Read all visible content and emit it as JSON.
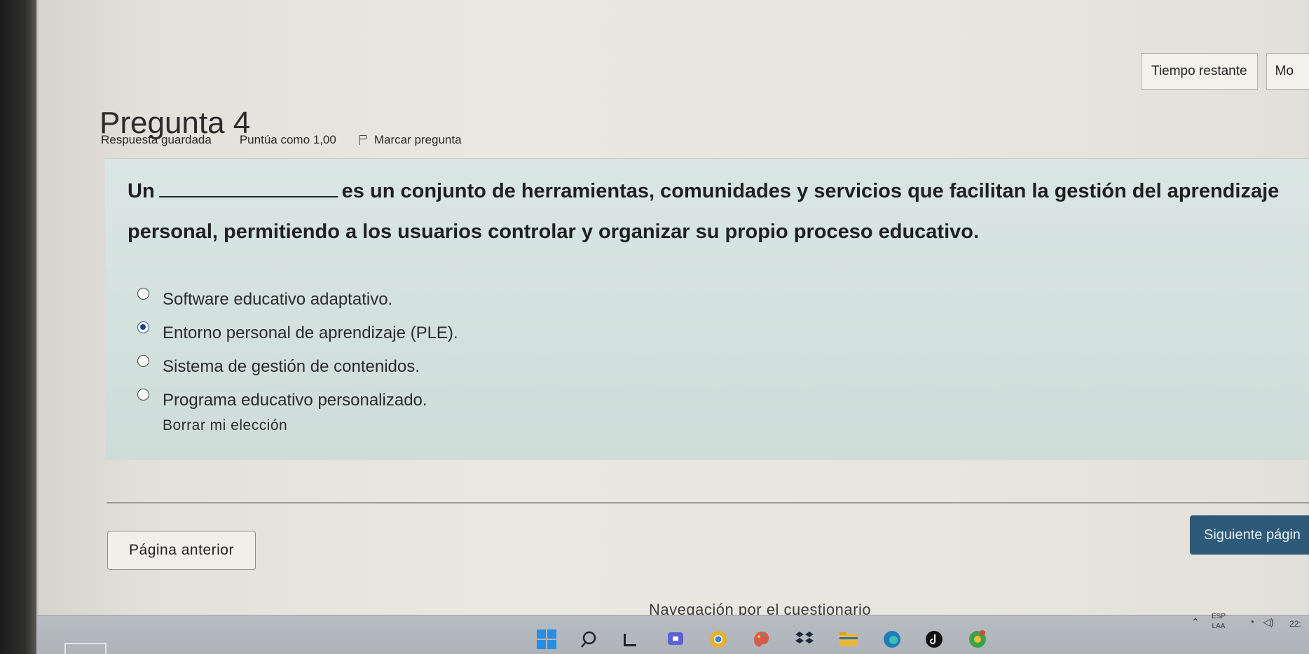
{
  "timer": {
    "label": "Tiempo restante",
    "value": "Mo"
  },
  "question": {
    "title": "Pregunta 4",
    "status": "Respuesta guardada",
    "grade": "Puntúa como 1,00",
    "flag_label": "Marcar pregunta",
    "text_before": "Un",
    "text_after": "es un conjunto de herramientas, comunidades y servicios que facilitan la gestión del aprendizaje personal, permitiendo a los usuarios controlar y organizar su propio proceso educativo.",
    "answers": [
      {
        "label": "Software educativo adaptativo.",
        "checked": false
      },
      {
        "label": "Entorno personal de aprendizaje (PLE).",
        "checked": true
      },
      {
        "label": "Sistema de gestión de contenidos.",
        "checked": false
      },
      {
        "label": "Programa educativo personalizado.",
        "checked": false
      }
    ],
    "clear_choice": "Borrar mi elección"
  },
  "nav": {
    "prev_label": "Página anterior",
    "next_label": "Siguiente págin",
    "quiz_nav_label": "Navegación por el cuestionario"
  },
  "taskbar": {
    "icons": [
      "windows-start-icon",
      "search-icon",
      "task-view-icon",
      "chat-icon",
      "chrome-icon",
      "paint-icon",
      "dropbox-icon",
      "file-explorer-icon",
      "edge-icon",
      "tiktok-icon",
      "chrome-canary-icon"
    ],
    "lang_top": "ESP",
    "lang_bottom": "LAA",
    "time": "22:"
  },
  "colors": {
    "formulation_bg": "#d4e2df",
    "next_button_bg": "#2e5a7a",
    "radio_checked": "#1c3f8e"
  }
}
